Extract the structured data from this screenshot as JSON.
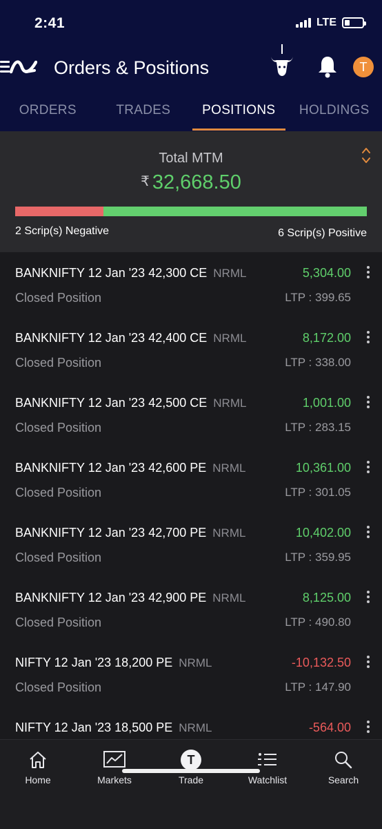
{
  "status_bar": {
    "time": "2:41",
    "network": "LTE"
  },
  "header": {
    "title": "Orders & Positions",
    "avatar_initial": "T"
  },
  "tabs": [
    {
      "label": "ORDERS",
      "active": false
    },
    {
      "label": "TRADES",
      "active": false
    },
    {
      "label": "POSITIONS",
      "active": true
    },
    {
      "label": "HOLDINGS",
      "active": false
    }
  ],
  "summary": {
    "label": "Total MTM",
    "currency": "₹",
    "value": "32,668.50",
    "negative_text": "2 Scrip(s) Negative",
    "positive_text": "6 Scrip(s) Positive",
    "negative_count": 2,
    "positive_count": 6
  },
  "positions": [
    {
      "name": "BANKNIFTY 12 Jan '23 42,300 CE",
      "product": "NRML",
      "pnl": "5,304.00",
      "sign": "pos",
      "status": "Closed Position",
      "ltp": "LTP : 399.65"
    },
    {
      "name": "BANKNIFTY 12 Jan '23 42,400 CE",
      "product": "NRML",
      "pnl": "8,172.00",
      "sign": "pos",
      "status": "Closed Position",
      "ltp": "LTP : 338.00"
    },
    {
      "name": "BANKNIFTY 12 Jan '23 42,500 CE",
      "product": "NRML",
      "pnl": "1,001.00",
      "sign": "pos",
      "status": "Closed Position",
      "ltp": "LTP : 283.15"
    },
    {
      "name": "BANKNIFTY 12 Jan '23 42,600 PE",
      "product": "NRML",
      "pnl": "10,361.00",
      "sign": "pos",
      "status": "Closed Position",
      "ltp": "LTP : 301.05"
    },
    {
      "name": "BANKNIFTY 12 Jan '23 42,700 PE",
      "product": "NRML",
      "pnl": "10,402.00",
      "sign": "pos",
      "status": "Closed Position",
      "ltp": "LTP : 359.95"
    },
    {
      "name": "BANKNIFTY 12 Jan '23 42,900 PE",
      "product": "NRML",
      "pnl": "8,125.00",
      "sign": "pos",
      "status": "Closed Position",
      "ltp": "LTP : 490.80"
    },
    {
      "name": "NIFTY 12 Jan '23 18,200 PE",
      "product": "NRML",
      "pnl": "-10,132.50",
      "sign": "neg",
      "status": "Closed Position",
      "ltp": "LTP : 147.90"
    },
    {
      "name": "NIFTY 12 Jan '23 18,500 PE",
      "product": "NRML",
      "pnl": "-564.00",
      "sign": "neg",
      "status": "",
      "ltp": ""
    }
  ],
  "bottom_nav": [
    {
      "label": "Home",
      "icon": "home-icon"
    },
    {
      "label": "Markets",
      "icon": "chart-icon"
    },
    {
      "label": "Trade",
      "icon": "trade-icon"
    },
    {
      "label": "Watchlist",
      "icon": "watchlist-icon"
    },
    {
      "label": "Search",
      "icon": "search-icon"
    }
  ],
  "colors": {
    "positive": "#5fcf6b",
    "negative": "#ea5a5a",
    "accent": "#e08a3e",
    "header_bg": "#0b0f3b"
  }
}
